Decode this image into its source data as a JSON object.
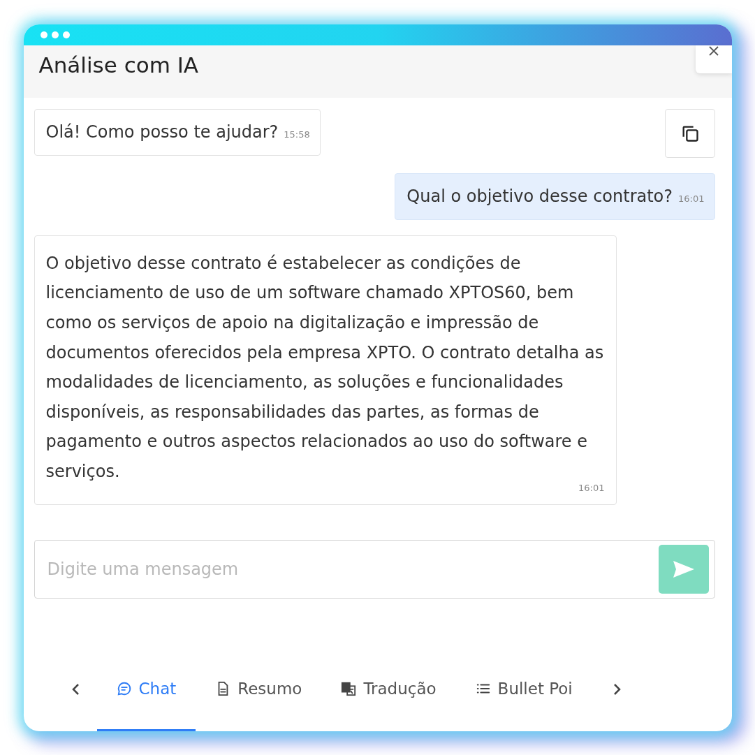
{
  "window": {
    "title": "Análise com IA"
  },
  "messages": [
    {
      "kind": "assistant",
      "text": "Olá! Como posso te ajudar?",
      "time": "15:58"
    },
    {
      "kind": "user",
      "text": "Qual o objetivo desse contrato?",
      "time": "16:01"
    },
    {
      "kind": "assistant",
      "text": "O objetivo desse contrato é estabelecer as condições de licenciamento de uso de um software chamado XPTOS60, bem como os serviços de apoio na digitalização e impressão de documentos oferecidos pela empresa XPTO. O contrato detalha as modalidades de licenciamento, as soluções e funcionalidades disponíveis, as responsabilidades das partes, as formas de pagamento e outros aspectos relacionados ao uso do software e serviços.",
      "time": "16:01"
    }
  ],
  "composer": {
    "placeholder": "Digite uma mensagem"
  },
  "tabs": [
    {
      "label": "Chat",
      "selected": true
    },
    {
      "label": "Resumo",
      "selected": false
    },
    {
      "label": "Tradução",
      "selected": false
    },
    {
      "label": "Bullet Poi",
      "selected": false
    }
  ]
}
